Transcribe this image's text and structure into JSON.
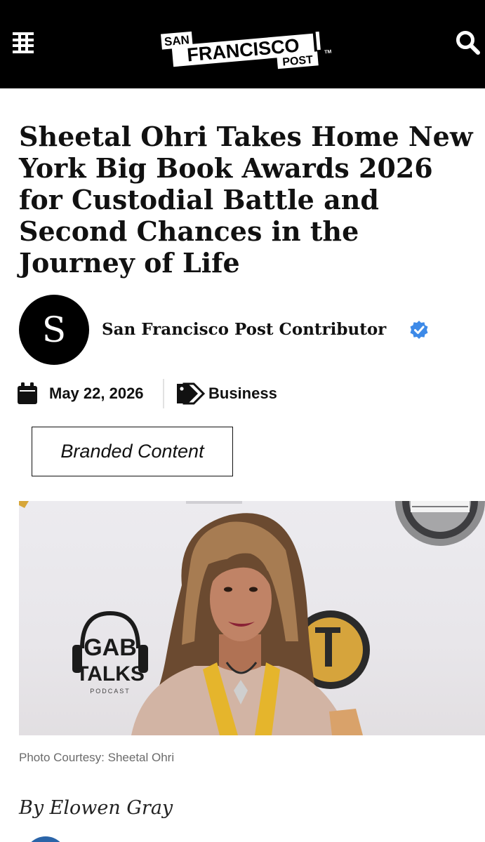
{
  "header": {
    "logo_line1": "SAN",
    "logo_line2": "FRANCISCO",
    "logo_line3": "POST",
    "logo_tm": "TM",
    "menu_icon": "hamburger-menu-icon",
    "search_icon": "search-icon"
  },
  "article": {
    "headline": "Sheetal Ohri Takes Home New York Big Book Awards 2026 for Custodial Battle and Second Chances in the Journey of Life",
    "author": {
      "avatar_letter": "S",
      "name": "San Francisco Post Contributor",
      "verified_icon": "verified-badge-icon"
    },
    "date": "May 22, 2026",
    "category": "Business",
    "branded_label": "Branded Content",
    "photo": {
      "caption": "Photo Courtesy: Sheetal Ohri",
      "logo_gab": "GAB",
      "logo_talks": "TALKS",
      "logo_podcast": "PODCAST"
    },
    "byline": "By Elowen Gray"
  },
  "colors": {
    "header_bg": "#000000",
    "verified_blue": "#3d8ae8",
    "caption_gray": "#6b6b6b"
  }
}
